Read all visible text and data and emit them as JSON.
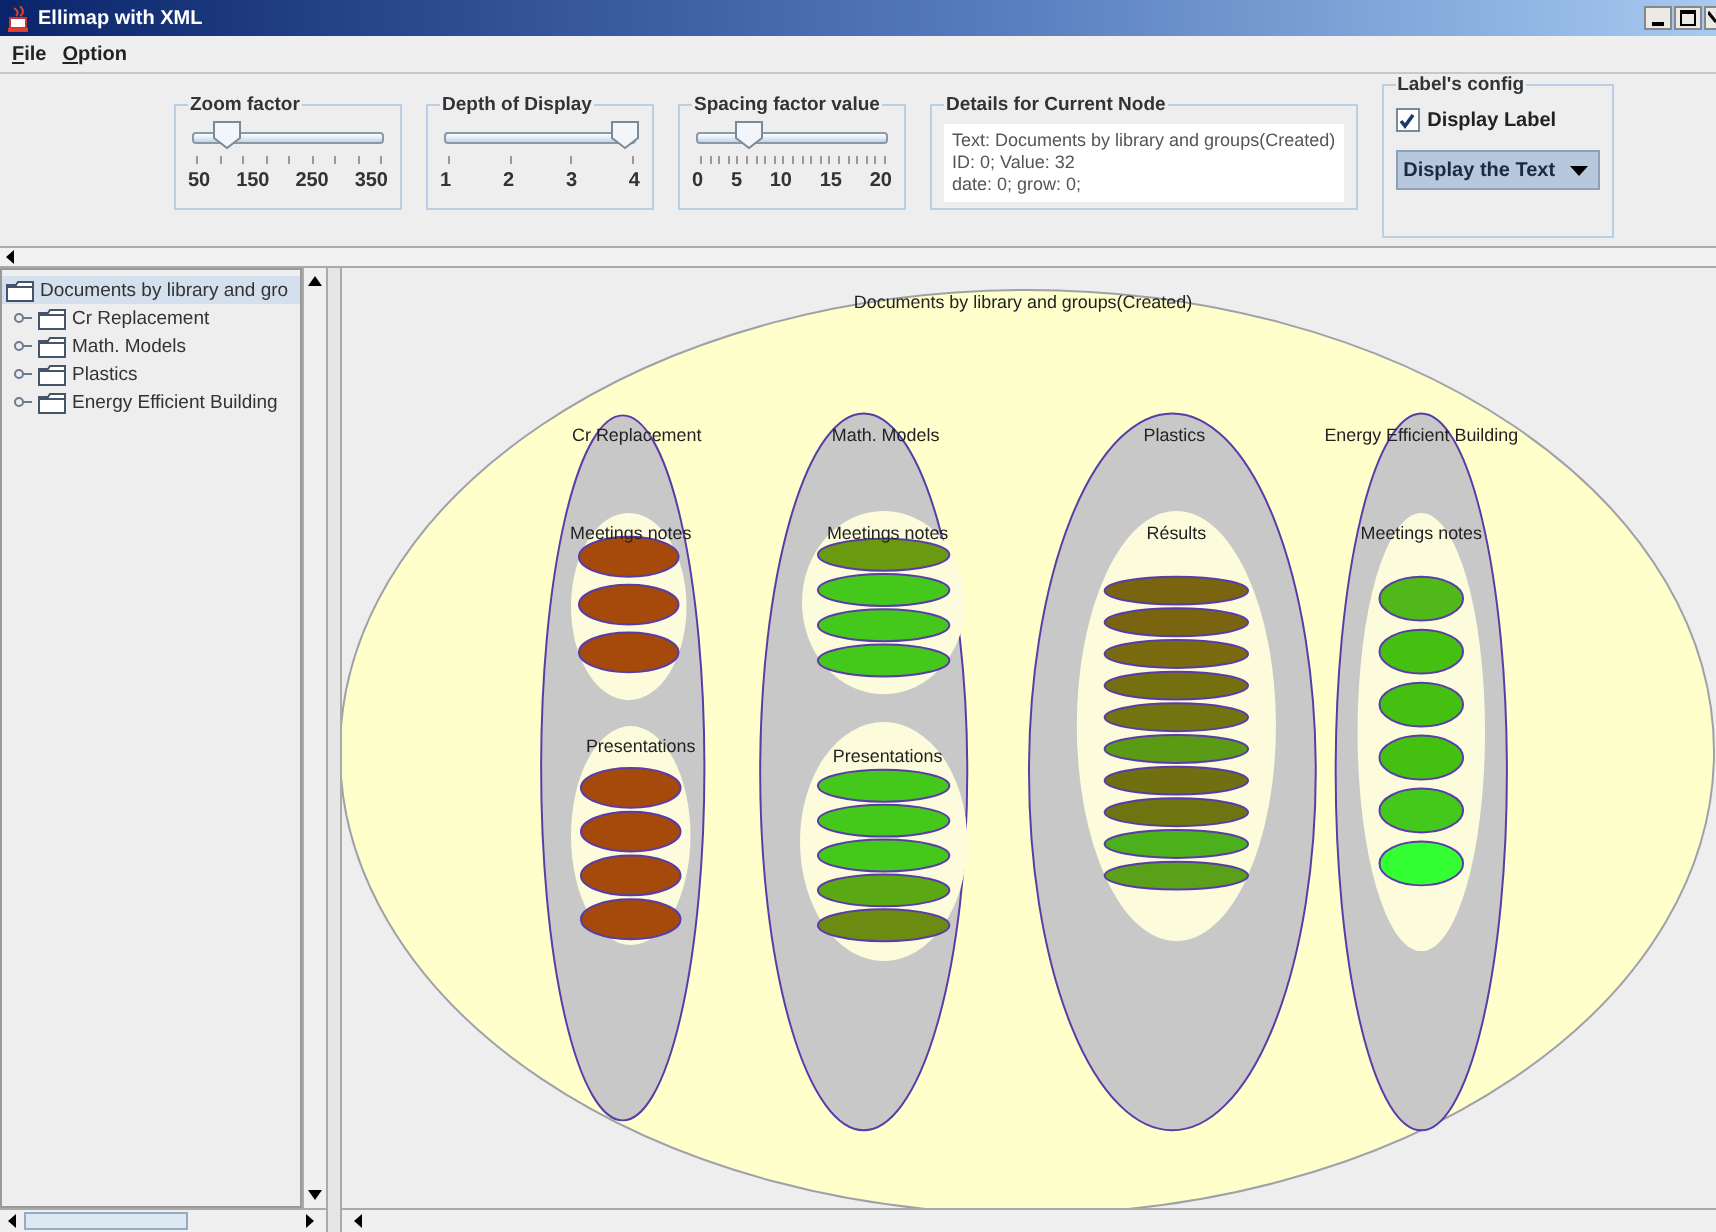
{
  "window": {
    "title": "Ellimap with XML"
  },
  "menu": [
    {
      "label": "File"
    },
    {
      "label": "Option"
    }
  ],
  "sliders": [
    {
      "title": "Zoom factor",
      "level": 0.14,
      "ticks": [
        "50",
        "150",
        "250",
        "350"
      ]
    },
    {
      "title": "Depth of Display",
      "level": 1.0,
      "ticks": [
        "1",
        "2",
        "3",
        "4"
      ]
    },
    {
      "title": "Spacing factor value",
      "level": 0.25,
      "ticks": [
        "0",
        "5",
        "10",
        "15",
        "20"
      ]
    }
  ],
  "details": {
    "title": "Details for Current Node",
    "lines": [
      "Text: Documents by library and groups(Created)",
      "ID: 0; Value: 32",
      "date: 0; grow: 0;"
    ]
  },
  "label_config": {
    "title": "Label's config",
    "checkbox": {
      "label": "Display Label",
      "checked": true
    },
    "combo": {
      "value": "Display the Text"
    }
  },
  "tree": {
    "root": {
      "label": "Documents by library and gro",
      "selected": true
    },
    "items": [
      {
        "label": "Cr Replacement",
        "selected": false
      },
      {
        "label": "Math. Models",
        "selected": false
      },
      {
        "label": "Plastics",
        "selected": false
      },
      {
        "label": "Energy Efficient Building",
        "selected": false
      }
    ]
  },
  "ellimap": {
    "label": "Documents by library and groups(Created)",
    "children": [
      {
        "label": "Cr Replacement",
        "children": [
          {
            "label": "Meetings notes",
            "children": [
              {
                "color": "#a64a0c"
              },
              {
                "color": "#a64a0c"
              },
              {
                "color": "#a64a0c"
              }
            ]
          },
          {
            "label": "Presentations",
            "children": [
              {
                "color": "#a64a0c"
              },
              {
                "color": "#a64a0c"
              },
              {
                "color": "#a64a0c"
              },
              {
                "color": "#a64a0c"
              }
            ]
          }
        ]
      },
      {
        "label": "Math. Models",
        "children": [
          {
            "label": "Meetings notes",
            "children": [
              {
                "color": "#6a9a10"
              },
              {
                "color": "#44c81c"
              },
              {
                "color": "#44c81c"
              },
              {
                "color": "#44c81c"
              }
            ]
          },
          {
            "label": "Presentations",
            "children": [
              {
                "color": "#44c81c"
              },
              {
                "color": "#44c81c"
              },
              {
                "color": "#44c81c"
              },
              {
                "color": "#5aa814"
              },
              {
                "color": "#6b8c10"
              }
            ]
          }
        ]
      },
      {
        "label": "Plastics",
        "children": [
          {
            "label": "Résults",
            "children": [
              {
                "color": "#7a6410"
              },
              {
                "color": "#7a6410"
              },
              {
                "color": "#7a6a10"
              },
              {
                "color": "#75700f"
              },
              {
                "color": "#727410"
              },
              {
                "color": "#5a9a14"
              },
              {
                "color": "#707010"
              },
              {
                "color": "#6e7410"
              },
              {
                "color": "#4cb01c"
              },
              {
                "color": "#5aa018"
              }
            ]
          }
        ]
      },
      {
        "label": "Energy Efficient Building",
        "children": [
          {
            "label": "Meetings notes",
            "children": [
              {
                "color": "#50b818"
              },
              {
                "color": "#44c010"
              },
              {
                "color": "#44c010"
              },
              {
                "color": "#44c010"
              },
              {
                "color": "#44c81c"
              },
              {
                "color": "#33ff33"
              }
            ]
          }
        ]
      }
    ]
  }
}
